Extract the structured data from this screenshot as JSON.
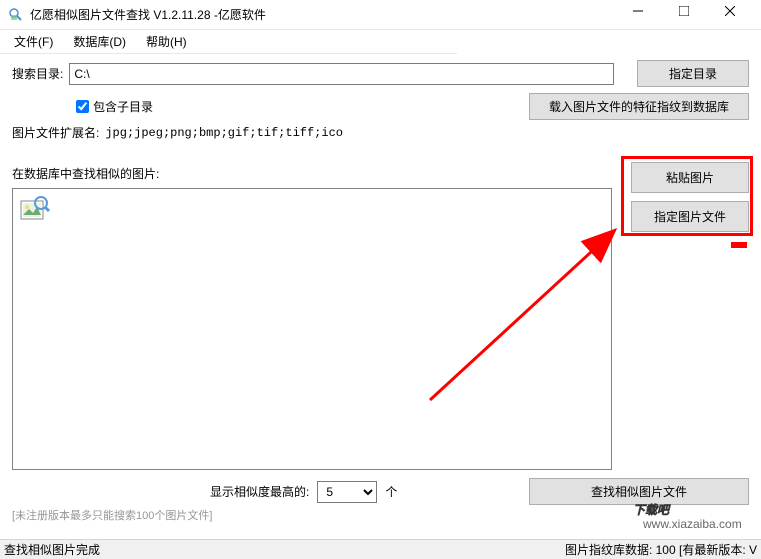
{
  "titlebar": {
    "title": "亿愿相似图片文件查找 V1.2.11.28 -亿愿软件"
  },
  "menu": {
    "file": "文件(F)",
    "database": "数据库(D)",
    "help": "帮助(H)"
  },
  "search": {
    "dir_label": "搜索目录:",
    "dir_value": "C:\\",
    "btn_specify_dir": "指定目录",
    "include_subdir": "包含子目录",
    "ext_label": "图片文件扩展名:",
    "ext_value": "jpg;jpeg;png;bmp;gif;tif;tiff;ico",
    "btn_load_fingerprint": "载入图片文件的特征指纹到数据库"
  },
  "similar": {
    "section_label": "在数据库中查找相似的图片:",
    "btn_paste_image": "粘贴图片",
    "btn_specify_file": "指定图片文件"
  },
  "bottom": {
    "show_label": "显示相似度最高的:",
    "count_value": "5",
    "count_unit": "个",
    "btn_search_similar": "查找相似图片文件",
    "unregistered_note": "[未注册版本最多只能搜索100个图片文件]"
  },
  "statusbar": {
    "left": "查找相似图片完成",
    "right": "图片指纹库数据: 100 [有最新版本: V"
  },
  "watermark": {
    "text": "下载吧",
    "url": "www.xiazaiba.com"
  }
}
